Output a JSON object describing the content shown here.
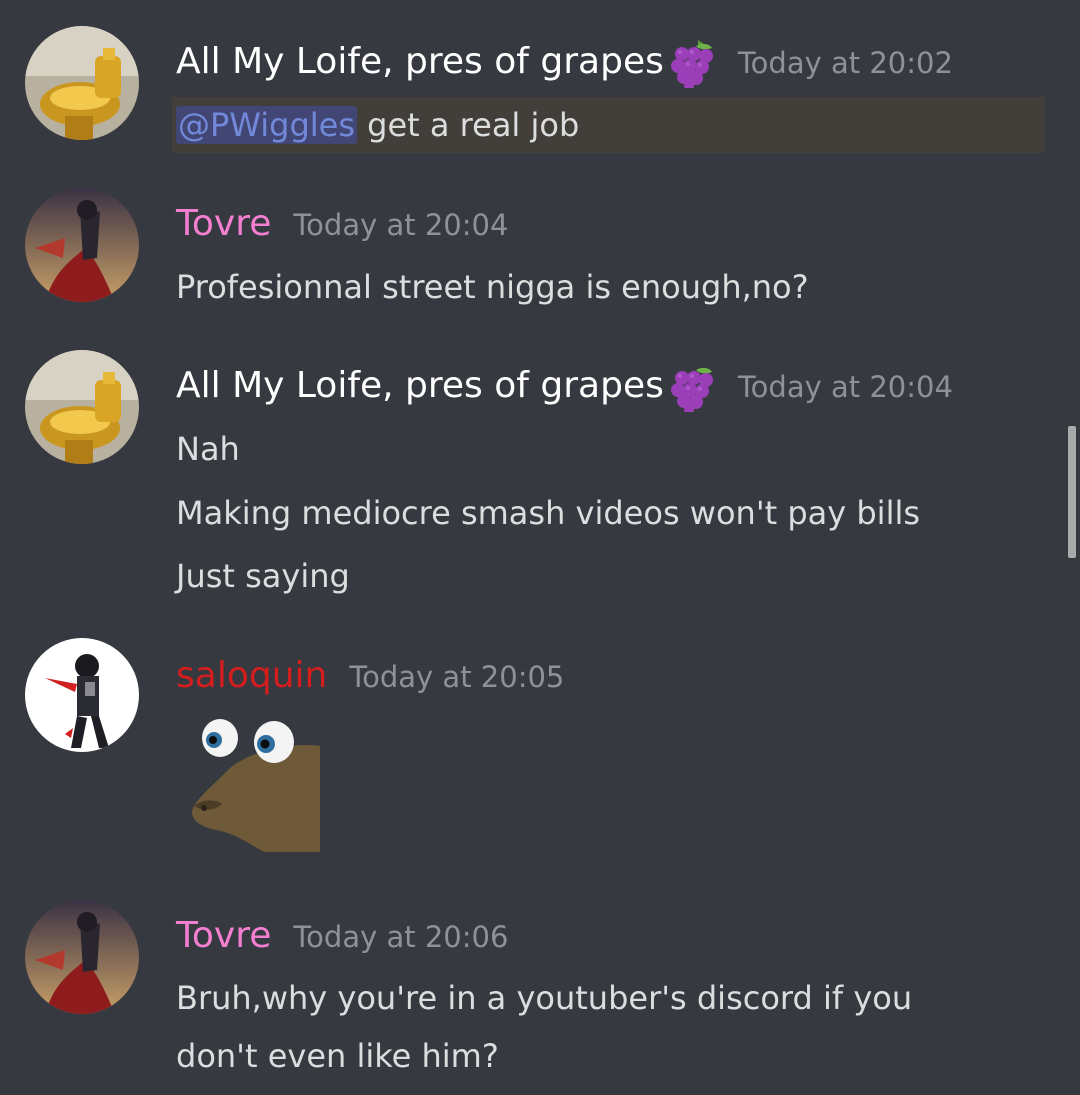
{
  "messages": [
    {
      "username": "All My Loife, pres of grapes",
      "badge_icon": "grapes-emoji-icon",
      "timestamp": "Today at 20:02",
      "mention": "@PWiggles",
      "lines": [
        " get a real job"
      ]
    },
    {
      "username": "Tovre",
      "timestamp": "Today at 20:04",
      "lines": [
        "Profesionnal street nigga is enough,no?"
      ]
    },
    {
      "username": "All My Loife, pres of grapes",
      "badge_icon": "grapes-emoji-icon",
      "timestamp": "Today at 20:04",
      "lines": [
        "Nah",
        "Making mediocre smash videos won't pay bills",
        "Just saying"
      ]
    },
    {
      "username": "saloquin",
      "timestamp": "Today at 20:05",
      "attachment_icon": "googly-eyed-seal-emote-icon"
    },
    {
      "username": "Tovre",
      "timestamp": "Today at 20:06",
      "lines": [
        "Bruh,why you're in a youtuber's discord if you",
        "don't even like him?"
      ]
    }
  ],
  "colors": {
    "background": "#36393f",
    "text": "#dcddde",
    "timestamp": "#8e9297",
    "tovre": "#f47fd0",
    "saloquin": "#d41e1e",
    "mention": "#7289da",
    "mention_highlight": "#423f3a"
  }
}
